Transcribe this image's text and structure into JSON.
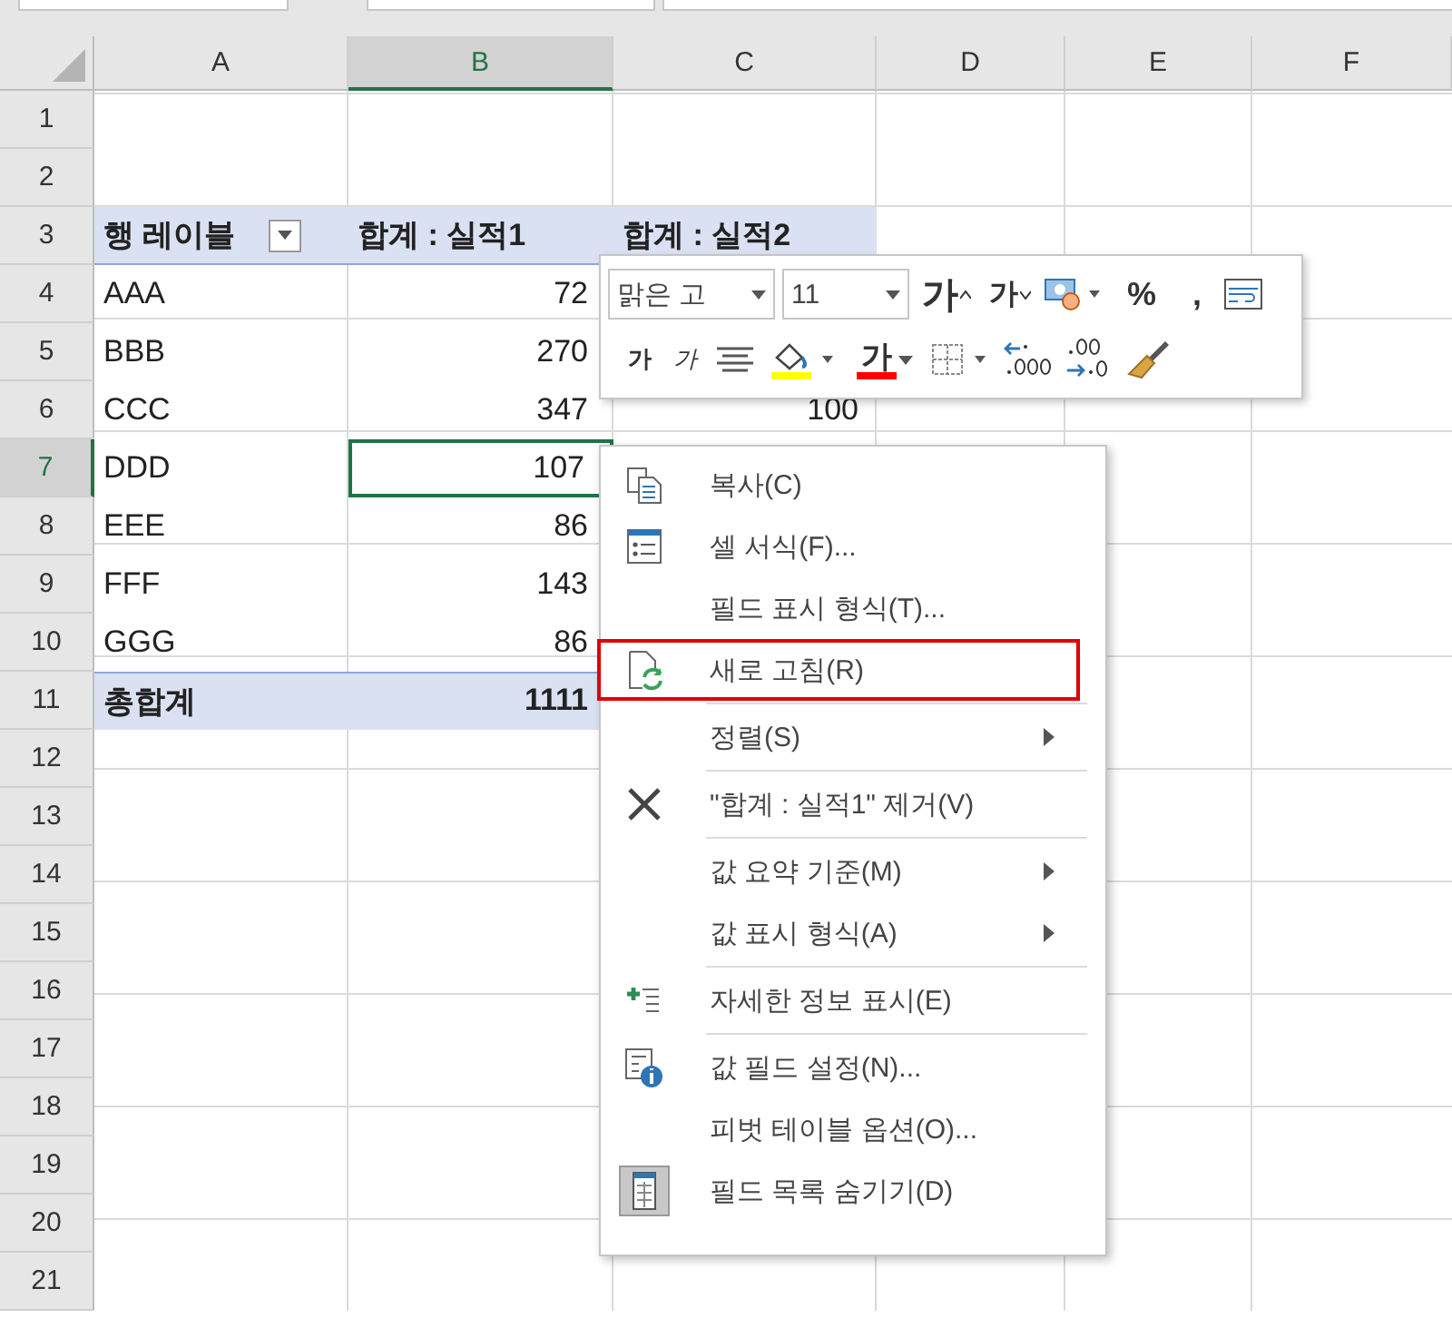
{
  "columns": [
    {
      "label": "A",
      "selected": false
    },
    {
      "label": "B",
      "selected": true
    },
    {
      "label": "C",
      "selected": false
    },
    {
      "label": "D",
      "selected": false
    },
    {
      "label": "E",
      "selected": false
    },
    {
      "label": "F",
      "selected": false
    }
  ],
  "rows": [
    {
      "label": "1",
      "selected": false
    },
    {
      "label": "2",
      "selected": false
    },
    {
      "label": "3",
      "selected": false
    },
    {
      "label": "4",
      "selected": false
    },
    {
      "label": "5",
      "selected": false
    },
    {
      "label": "6",
      "selected": false
    },
    {
      "label": "7",
      "selected": true
    },
    {
      "label": "8",
      "selected": false
    },
    {
      "label": "9",
      "selected": false
    },
    {
      "label": "10",
      "selected": false
    },
    {
      "label": "11",
      "selected": false
    },
    {
      "label": "12",
      "selected": false
    },
    {
      "label": "13",
      "selected": false
    },
    {
      "label": "14",
      "selected": false
    },
    {
      "label": "15",
      "selected": false
    },
    {
      "label": "16",
      "selected": false
    },
    {
      "label": "17",
      "selected": false
    },
    {
      "label": "18",
      "selected": false
    },
    {
      "label": "19",
      "selected": false
    },
    {
      "label": "20",
      "selected": false
    },
    {
      "label": "21",
      "selected": false
    }
  ],
  "pivot": {
    "header": [
      "행 레이블",
      "합계 : 실적1",
      "합계 : 실적2"
    ],
    "rows": [
      {
        "label": "AAA",
        "values": [
          "72"
        ],
        "selected": false
      },
      {
        "label": "BBB",
        "values": [
          "270"
        ],
        "selected": false
      },
      {
        "label": "CCC",
        "values": [
          "347",
          "100"
        ],
        "selected": false
      },
      {
        "label": "DDD",
        "values": [
          "107"
        ],
        "selected": true
      },
      {
        "label": "EEE",
        "values": [
          "86"
        ],
        "selected": false
      },
      {
        "label": "FFF",
        "values": [
          "143"
        ],
        "selected": false
      },
      {
        "label": "GGG",
        "values": [
          "86"
        ],
        "selected": false
      }
    ],
    "total": {
      "label": "총합계",
      "values": [
        "1111"
      ]
    }
  },
  "mini_toolbar": {
    "font_field": {
      "value": "맑은 고"
    },
    "size_field": {
      "value": "11"
    },
    "row_1": [
      {
        "kind": "grow",
        "text": "가"
      },
      {
        "kind": "shrink",
        "text": "가"
      },
      {
        "kind": "accounting"
      },
      {
        "kind": "text",
        "text": "%"
      },
      {
        "kind": "text",
        "text": ","
      },
      {
        "kind": "wrap"
      }
    ],
    "row_2": [
      {
        "kind": "bold",
        "text": "가"
      },
      {
        "kind": "italic",
        "text": "가"
      },
      {
        "kind": "align"
      },
      {
        "kind": "fill",
        "color": "#ffff00"
      },
      {
        "kind": "fontcolor",
        "text": "가",
        "color": "#ff0000"
      },
      {
        "kind": "border"
      },
      {
        "kind": "incdec"
      },
      {
        "kind": "decdec"
      },
      {
        "kind": "painter"
      }
    ]
  },
  "context_menu": {
    "items": [
      {
        "kind": "copy",
        "label": "복사(C)",
        "submenu": false,
        "highlighted": false,
        "checked": false
      },
      {
        "kind": "format",
        "label": "셀 서식(F)...",
        "submenu": false,
        "highlighted": false,
        "checked": false
      },
      {
        "kind": "plain",
        "label": "필드 표시 형식(T)...",
        "submenu": false,
        "highlighted": false,
        "checked": false
      },
      {
        "kind": "refresh",
        "label": "새로 고침(R)",
        "submenu": false,
        "highlighted": true,
        "checked": false
      },
      {
        "kind": "separator"
      },
      {
        "kind": "plain",
        "label": "정렬(S)",
        "submenu": true,
        "highlighted": false,
        "checked": false
      },
      {
        "kind": "separator"
      },
      {
        "kind": "remove",
        "label": "\"합계 : 실적1\" 제거(V)",
        "submenu": false,
        "highlighted": false,
        "checked": false
      },
      {
        "kind": "separator"
      },
      {
        "kind": "plain",
        "label": "값 요약 기준(M)",
        "submenu": true,
        "highlighted": false,
        "checked": false
      },
      {
        "kind": "plain",
        "label": "값 표시 형식(A)",
        "submenu": true,
        "highlighted": false,
        "checked": false
      },
      {
        "kind": "separator"
      },
      {
        "kind": "details",
        "label": "자세한 정보 표시(E)",
        "submenu": false,
        "highlighted": false,
        "checked": false
      },
      {
        "kind": "separator"
      },
      {
        "kind": "settings",
        "label": "값 필드 설정(N)...",
        "submenu": false,
        "highlighted": false,
        "checked": false
      },
      {
        "kind": "plain",
        "label": "피벗 테이블 옵션(O)...",
        "submenu": false,
        "highlighted": false,
        "checked": false
      },
      {
        "kind": "fieldlist",
        "label": "필드 목록 숨기기(D)",
        "submenu": false,
        "highlighted": false,
        "checked": true
      }
    ]
  }
}
